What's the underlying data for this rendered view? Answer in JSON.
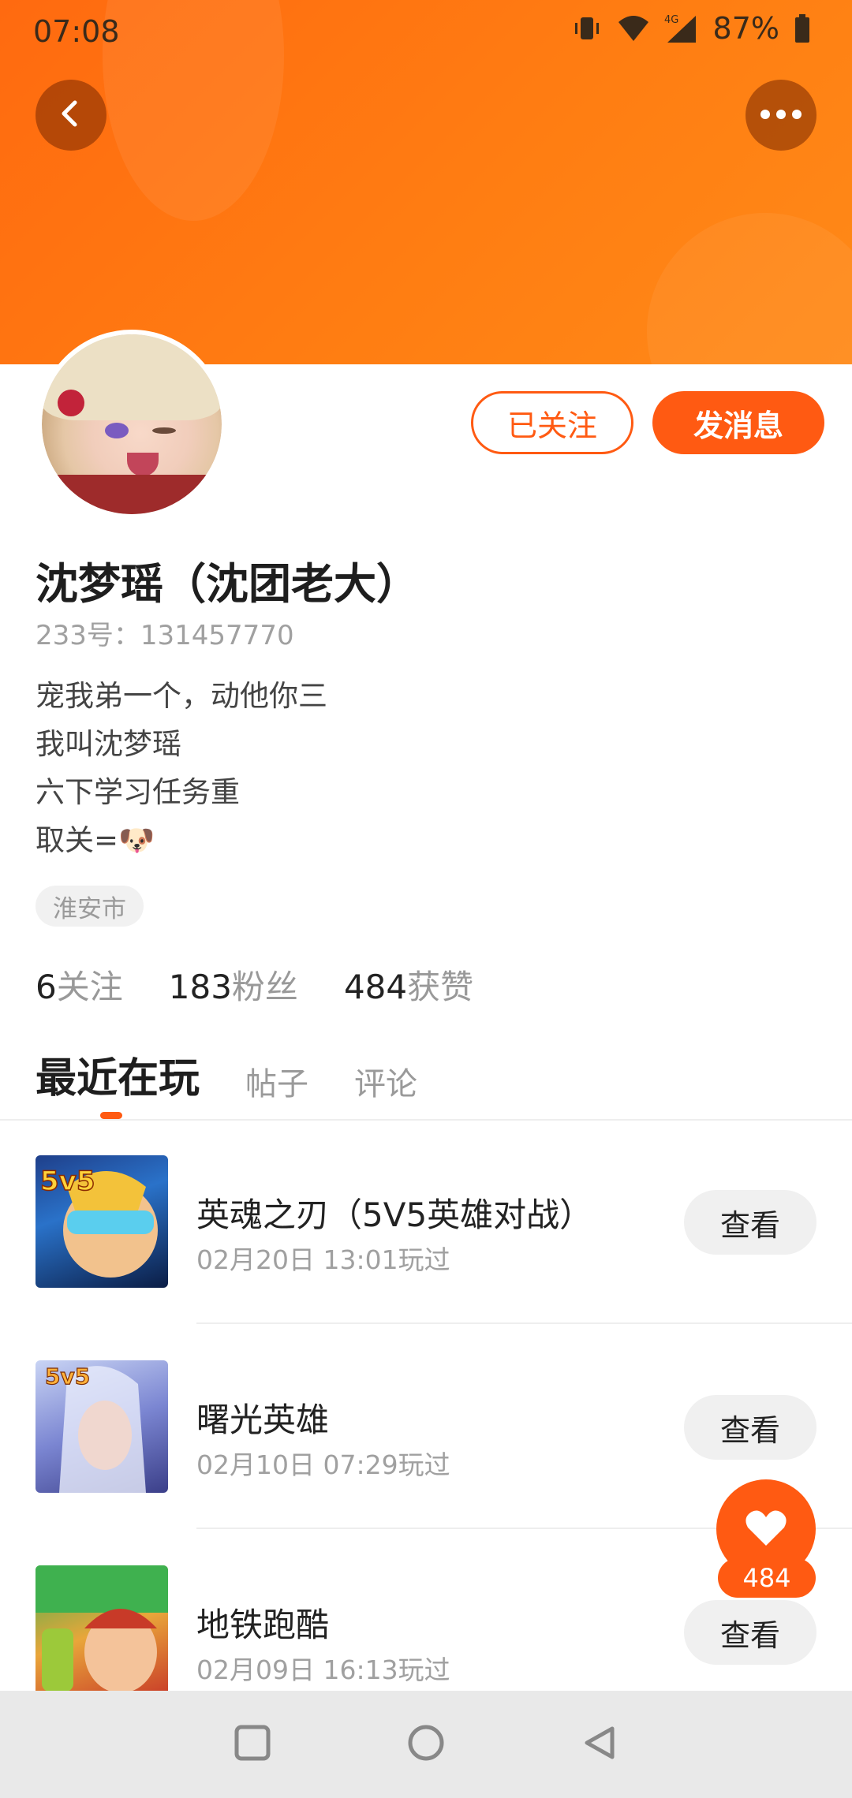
{
  "status_bar": {
    "time": "07:08",
    "battery_pct": "87%",
    "network": "4G",
    "icons": [
      "vibrate-icon",
      "wifi-icon",
      "signal-icon",
      "battery-icon"
    ]
  },
  "header": {
    "back_icon": "chevron-left-icon",
    "more_icon": "more-dots-icon",
    "accent_color": "#ff5a12"
  },
  "profile": {
    "name": "沈梦瑶（沈团老大）",
    "uid": "233号：131457770",
    "bio": [
      "宠我弟一个，动他你三",
      "我叫沈梦瑶",
      "六下学习任务重",
      "取关=🐶"
    ],
    "location": "淮安市",
    "followed_label": "已关注",
    "message_label": "发消息",
    "stats": [
      {
        "num": "6",
        "label": "关注"
      },
      {
        "num": "183",
        "label": "粉丝"
      },
      {
        "num": "484",
        "label": "获赞"
      }
    ]
  },
  "tabs": [
    {
      "label": "最近在玩",
      "active": true
    },
    {
      "label": "帖子",
      "active": false
    },
    {
      "label": "评论",
      "active": false
    }
  ],
  "games": [
    {
      "title": "英魂之刃（5V5英雄对战）",
      "time": "02月20日 13:01玩过",
      "button": "查看",
      "badge": "5v5"
    },
    {
      "title": "曙光英雄",
      "time": "02月10日 07:29玩过",
      "button": "查看",
      "badge": "5v5"
    },
    {
      "title": "地铁跑酷",
      "time": "02月09日 16:13玩过",
      "button": "查看"
    }
  ],
  "like_fab": {
    "count": "484",
    "icon": "heart-icon"
  },
  "nav_bar": {
    "icons": [
      "square-recents-icon",
      "circle-home-icon",
      "triangle-back-icon"
    ]
  }
}
